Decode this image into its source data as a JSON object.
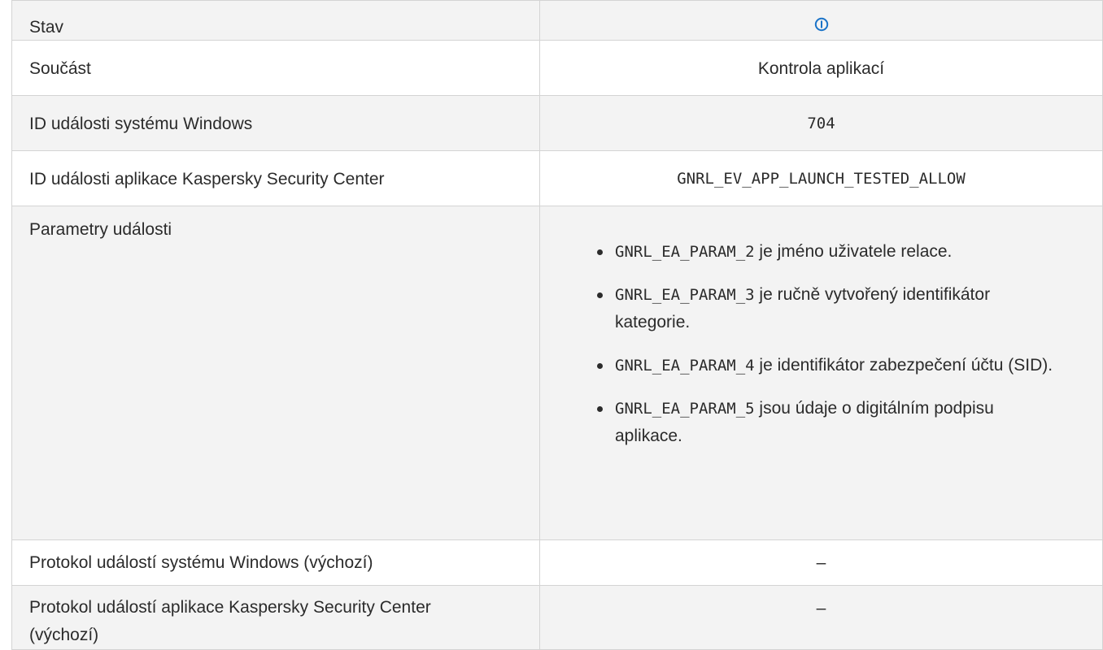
{
  "rows": [
    {
      "label": "Stav",
      "value": "",
      "icon": "info-status-icon"
    },
    {
      "label": "Součást",
      "value": "Kontrola aplikací"
    },
    {
      "label": "ID události systému Windows",
      "value": "704"
    },
    {
      "label": "ID události aplikace Kaspersky Security Center",
      "value": "GNRL_EV_APP_LAUNCH_TESTED_ALLOW"
    },
    {
      "label": "Parametry události"
    },
    {
      "label": "Protokol událostí systému Windows (výchozí)",
      "value": "–"
    },
    {
      "label": "Protokol událostí aplikace Kaspersky Security Center (výchozí)",
      "value": "–"
    }
  ],
  "params": [
    {
      "code": "GNRL_EA_PARAM_2",
      "text": " je jméno uživatele relace."
    },
    {
      "code": "GNRL_EA_PARAM_3",
      "text": " je ručně vytvořený identifikátor kategorie."
    },
    {
      "code": "GNRL_EA_PARAM_4",
      "text": " je identifikátor zabezpečení účtu (SID)."
    },
    {
      "code": "GNRL_EA_PARAM_5",
      "text": " jsou údaje o digitálním podpisu aplikace."
    }
  ],
  "colors": {
    "icon": "#1a73c8",
    "border": "#d4d4d4",
    "stripe": "#f3f3f3"
  }
}
